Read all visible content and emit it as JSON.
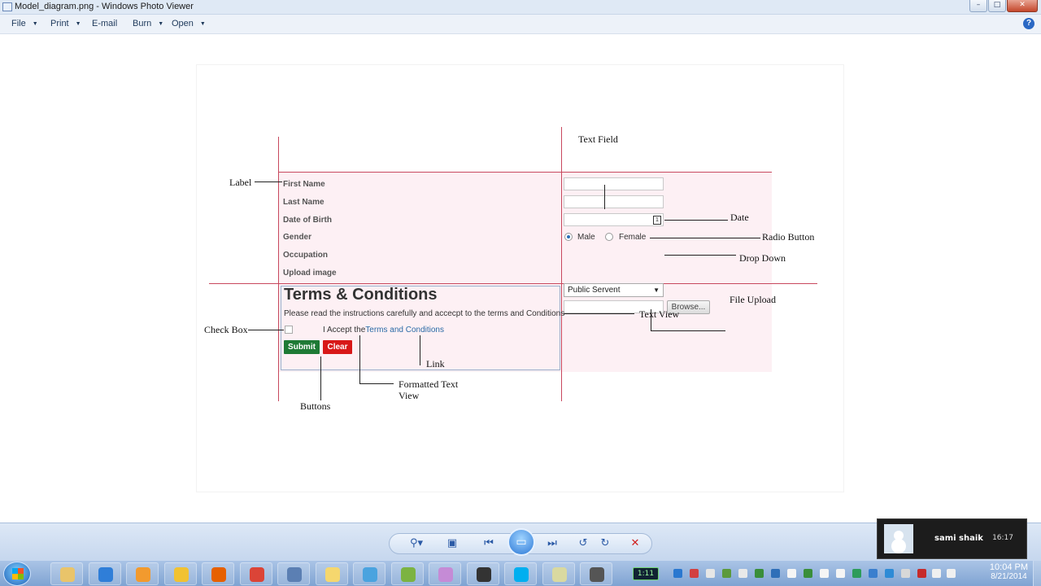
{
  "window": {
    "title": "Model_diagram.png - Windows Photo Viewer",
    "controls": [
      "minimize",
      "maximize",
      "close"
    ]
  },
  "menu": {
    "items": [
      {
        "label": "File",
        "has_caret": true
      },
      {
        "label": "Print",
        "has_caret": true
      },
      {
        "label": "E-mail",
        "has_caret": false
      },
      {
        "label": "Burn",
        "has_caret": true
      },
      {
        "label": "Open",
        "has_caret": true
      }
    ],
    "help_icon": "help-icon"
  },
  "diagram": {
    "form": {
      "labels": [
        "First Name",
        "Last Name",
        "Date of Birth",
        "Gender",
        "Occupation",
        "Upload image"
      ],
      "gender_options": [
        "Male",
        "Female"
      ],
      "gender_selected": "Male",
      "occupation_value": "Public Servent",
      "browse_label": "Browse...",
      "terms_title": "Terms & Conditions",
      "terms_text": "Please read the instructions carefully and accecpt to the terms and Conditions",
      "accept_prefix": "I Accept the",
      "accept_link": "Terms and Conditions",
      "submit_label": "Submit",
      "clear_label": "Clear"
    },
    "annotations": {
      "text_field": "Text Field",
      "label": "Label",
      "date": "Date",
      "radio_button": "Radio Button",
      "drop_down": "Drop Down",
      "file_upload": "File Upload",
      "text_view": "Text View",
      "check_box": "Check Box",
      "link": "Link",
      "formatted_text_view_line1": "Formatted Text",
      "formatted_text_view_line2": "View",
      "buttons": "Buttons"
    }
  },
  "viewer_toolbar": {
    "buttons": [
      "zoom-icon",
      "fit-window-icon",
      "previous-icon",
      "slideshow-icon",
      "next-icon",
      "rotate-ccw-icon",
      "rotate-cw-icon",
      "delete-icon"
    ]
  },
  "notification": {
    "name": "sami shaik",
    "time": "16:17"
  },
  "taskbar": {
    "battery_text": "1:11",
    "clock_time": "10:04 PM",
    "clock_date": "8/21/2014",
    "apps": [
      {
        "name": "explorer",
        "color": "#e9c46a"
      },
      {
        "name": "internet-explorer",
        "color": "#2f7ed8"
      },
      {
        "name": "outlook",
        "color": "#f29a2e"
      },
      {
        "name": "windows-folder",
        "color": "#f1c232"
      },
      {
        "name": "firefox",
        "color": "#e66000"
      },
      {
        "name": "chrome",
        "color": "#db4437"
      },
      {
        "name": "remote-desktop",
        "color": "#5b7fb3"
      },
      {
        "name": "folder",
        "color": "#f5d76e"
      },
      {
        "name": "network-app",
        "color": "#4aa3df"
      },
      {
        "name": "spreadsheet-app",
        "color": "#7cb342"
      },
      {
        "name": "paint-app",
        "color": "#c58bd6"
      },
      {
        "name": "linux-app",
        "color": "#333333"
      },
      {
        "name": "skype",
        "color": "#00aff0"
      },
      {
        "name": "notes-app",
        "color": "#d9d9a0"
      },
      {
        "name": "media-app",
        "color": "#555555"
      }
    ]
  }
}
